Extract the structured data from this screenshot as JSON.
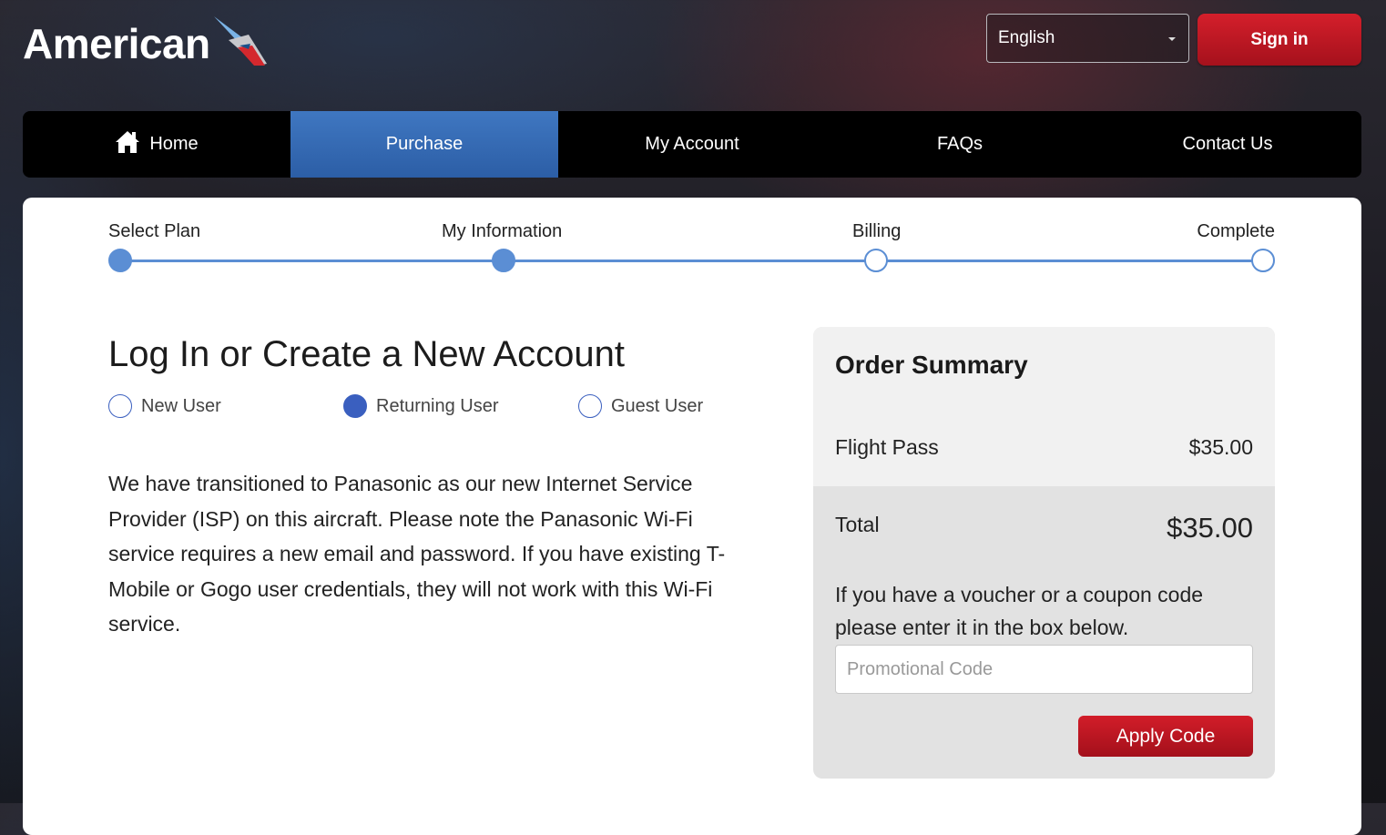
{
  "header": {
    "logo_text": "American",
    "language": "English",
    "signin_label": "Sign in"
  },
  "nav": {
    "items": [
      {
        "label": "Home",
        "icon": "home-icon"
      },
      {
        "label": "Purchase",
        "active": true
      },
      {
        "label": "My Account"
      },
      {
        "label": "FAQs"
      },
      {
        "label": "Contact Us"
      }
    ]
  },
  "progress": {
    "steps": [
      {
        "label": "Select Plan",
        "state": "done"
      },
      {
        "label": "My Information",
        "state": "done"
      },
      {
        "label": "Billing",
        "state": "todo"
      },
      {
        "label": "Complete",
        "state": "todo"
      }
    ]
  },
  "main": {
    "title": "Log In or Create a New Account",
    "user_types": [
      {
        "label": "New User",
        "selected": false
      },
      {
        "label": "Returning User",
        "selected": true
      },
      {
        "label": "Guest User",
        "selected": false
      }
    ],
    "notice": "We have transitioned to Panasonic as our new Internet Service Provider (ISP) on this aircraft. Please note the Panasonic Wi-Fi service requires a new email and password. If you have existing T-Mobile or Gogo user credentials, they will not work with this Wi-Fi service."
  },
  "summary": {
    "title": "Order Summary",
    "item_name": "Flight Pass",
    "item_price": "$35.00",
    "total_label": "Total",
    "total_value": "$35.00",
    "voucher_text": "If you have a voucher or a coupon code please enter it in the box below.",
    "promo_placeholder": "Promotional Code",
    "apply_label": "Apply Code"
  },
  "colors": {
    "accent_blue": "#5b8ed4",
    "brand_red": "#c4161f",
    "nav_active": "#3565b0"
  }
}
